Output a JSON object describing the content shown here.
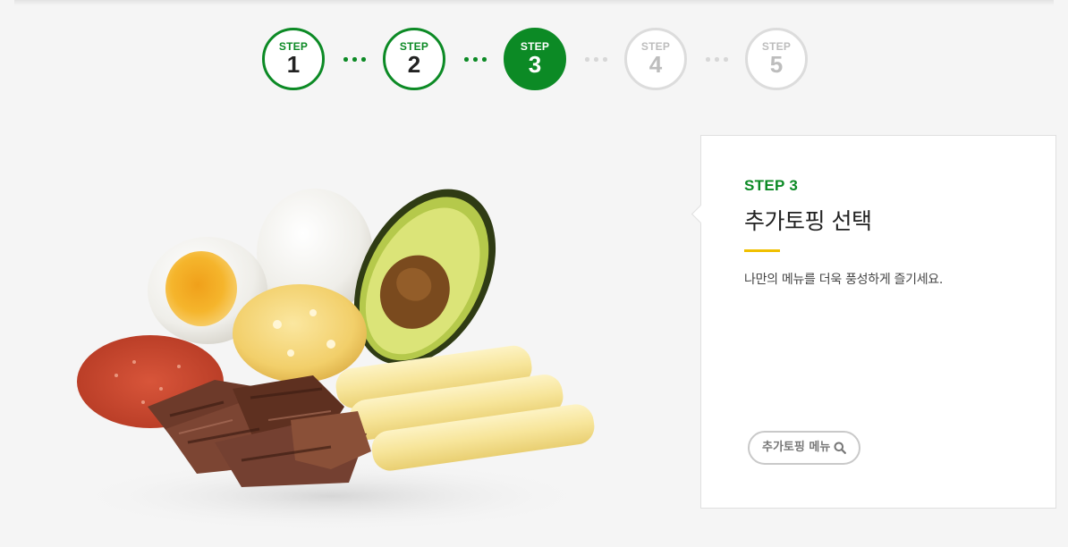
{
  "stepper": {
    "steps": [
      {
        "label": "STEP",
        "number": "1",
        "state": "done"
      },
      {
        "label": "STEP",
        "number": "2",
        "state": "done"
      },
      {
        "label": "STEP",
        "number": "3",
        "state": "active"
      },
      {
        "label": "STEP",
        "number": "4",
        "state": "todo"
      },
      {
        "label": "STEP",
        "number": "5",
        "state": "todo"
      }
    ]
  },
  "card": {
    "step_tag": "STEP 3",
    "title": "추가토핑 선택",
    "description": "나만의 메뉴를 더욱 풍성하게 즐기세요.",
    "menu_button": "추가토핑 메뉴"
  },
  "colors": {
    "accent": "#0c8a25",
    "highlight": "#f0c000",
    "inactive": "#dcdcdc"
  },
  "icons": [
    "search-icon"
  ]
}
